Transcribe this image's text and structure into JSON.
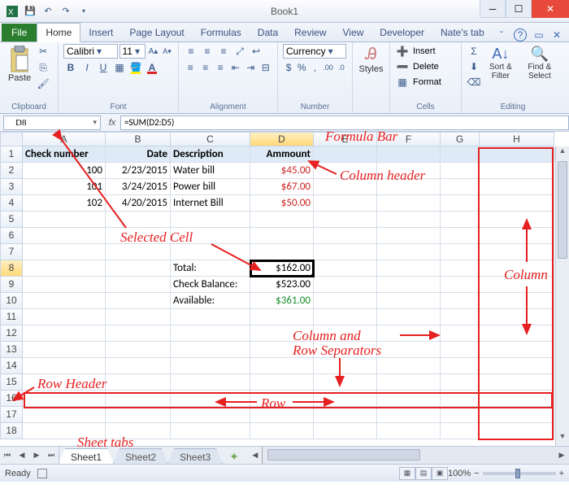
{
  "title": "Book1",
  "qat": {
    "save": "save-icon",
    "undo": "undo-icon",
    "redo": "redo-icon"
  },
  "ribbon_tabs": {
    "file": "File",
    "items": [
      "Home",
      "Insert",
      "Page Layout",
      "Formulas",
      "Data",
      "Review",
      "View",
      "Developer",
      "Nate's tab"
    ],
    "active": 0
  },
  "ribbon": {
    "clipboard": {
      "paste": "Paste",
      "label": "Clipboard"
    },
    "font": {
      "family": "Calibri",
      "size": "11",
      "label": "Font"
    },
    "alignment": {
      "label": "Alignment"
    },
    "number": {
      "format": "Currency",
      "label": "Number"
    },
    "styles": {
      "btn": "Styles"
    },
    "cells": {
      "insert": "Insert",
      "delete": "Delete",
      "format": "Format",
      "label": "Cells"
    },
    "editing": {
      "sortfilter": "Sort & Filter",
      "findselect": "Find & Select",
      "label": "Editing"
    }
  },
  "name_box": "D8",
  "formula": "=SUM(D2:D5)",
  "columns": [
    "A",
    "B",
    "C",
    "D",
    "E",
    "F",
    "G",
    "H"
  ],
  "rows_count": 18,
  "selected_cell": {
    "row": 8,
    "col": "D"
  },
  "headers": {
    "A": "Check number",
    "B": "Date",
    "C": "Description",
    "D": "Ammount"
  },
  "data_rows": [
    {
      "A": "100",
      "B": "2/23/2015",
      "C": "Water bill",
      "D": "$45.00"
    },
    {
      "A": "101",
      "B": "3/24/2015",
      "C": "Power bill",
      "D": "$67.00"
    },
    {
      "A": "102",
      "B": "4/20/2015",
      "C": "Internet Bill",
      "D": "$50.00"
    }
  ],
  "summary": {
    "total_label": "Total:",
    "total": "$162.00",
    "balance_label": "Check Balance:",
    "balance": "$523.00",
    "available_label": "Available:",
    "available": "$361.00"
  },
  "sheets": [
    "Sheet1",
    "Sheet2",
    "Sheet3"
  ],
  "status": {
    "ready": "Ready",
    "zoom": "100%"
  },
  "annotations": {
    "formula_bar": "Formula Bar",
    "selected_cell": "Selected Cell",
    "column_header": "Column header",
    "column": "Column",
    "row": "Row",
    "row_header": "Row Header",
    "sep": "Column and\nRow Separators",
    "sheet_tabs": "Sheet tabs"
  }
}
